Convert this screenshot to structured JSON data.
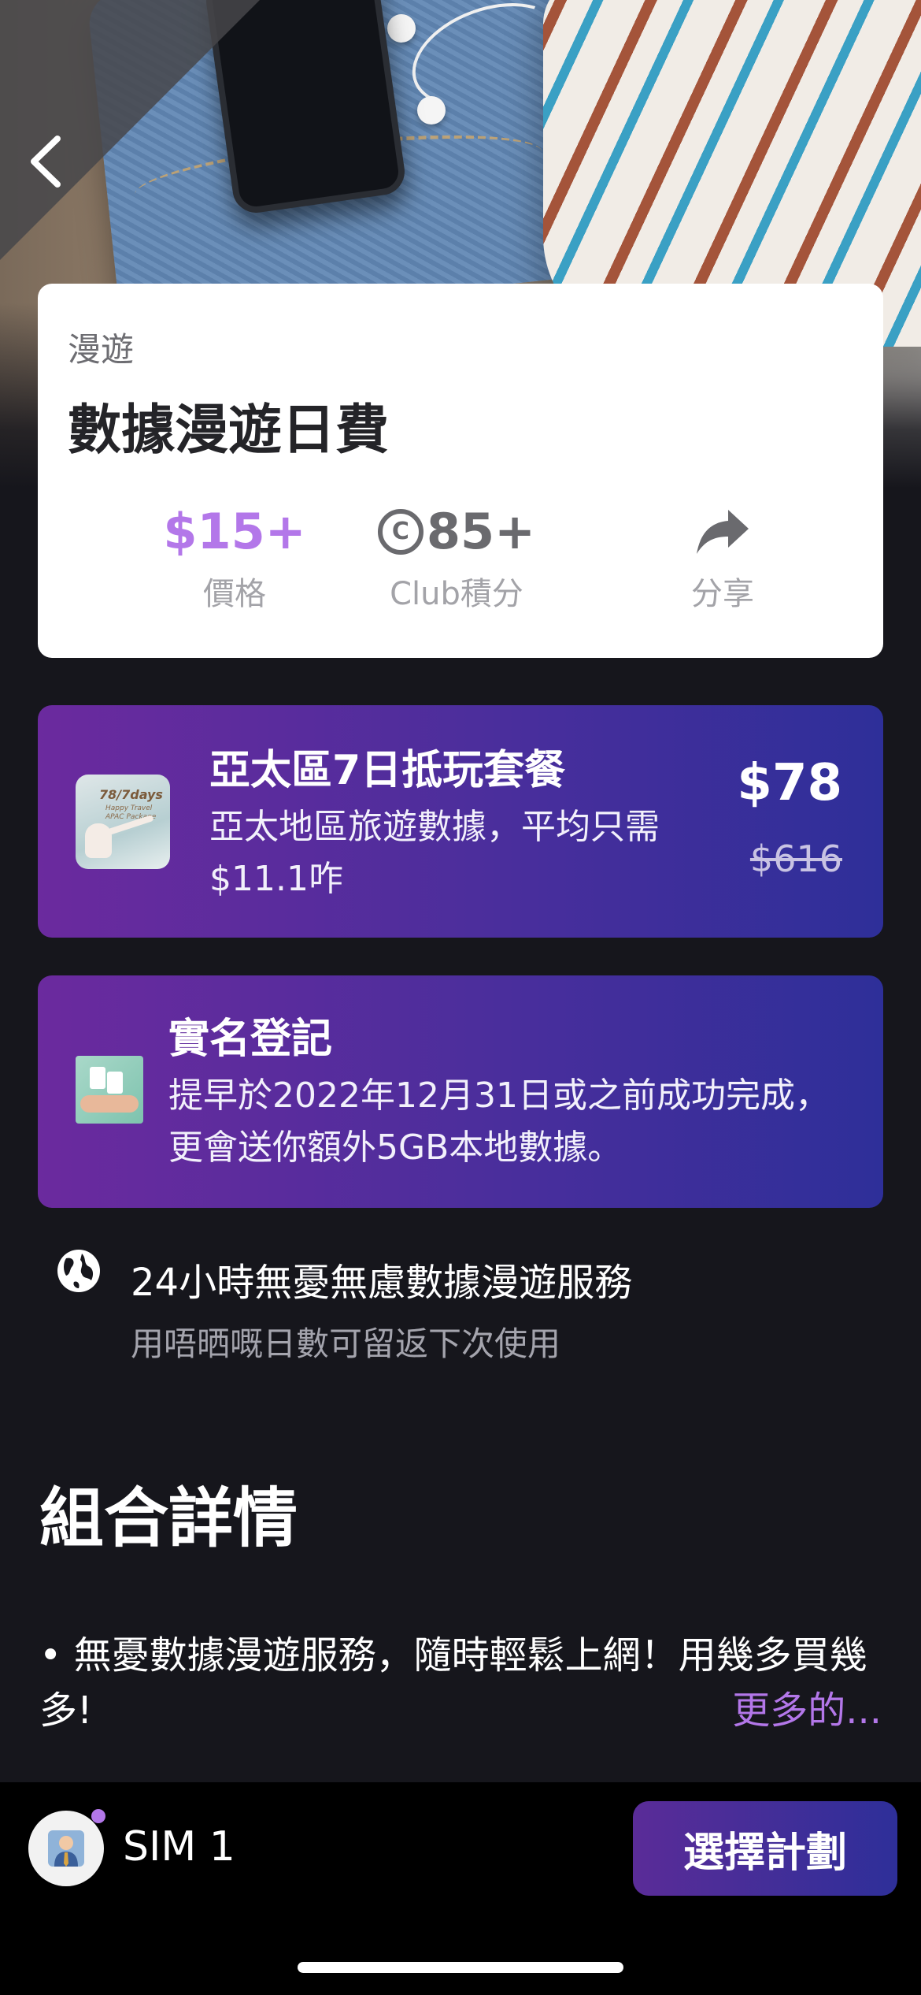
{
  "product": {
    "category": "漫遊",
    "title": "數據漫遊日費",
    "price": "$15+",
    "price_label": "價格",
    "points_icon_letter": "C",
    "points": "85+",
    "points_label": "Club積分",
    "share_label": "分享"
  },
  "promo_package": {
    "title": "亞太區7日抵玩套餐",
    "description": "亞太地區旅遊數據，平均只需$11.1咋",
    "price": "$78",
    "original_price": "$616",
    "thumb_text": "78/7days",
    "thumb_subtext": "Happy Travel APAC Package"
  },
  "registration": {
    "title": "實名登記",
    "description": "提早於2022年12月31日或之前成功完成，更會送你額外5GB本地數據。"
  },
  "feature": {
    "icon": "globe-icon",
    "title": "24小時無憂無慮數據漫遊服務",
    "subtitle": "用唔晒嘅日數可留返下次使用"
  },
  "details": {
    "heading": "組合詳情",
    "text": "• 無憂數據漫遊服務，隨時輕鬆上網！用幾多買幾多!",
    "more_link": "更多的..."
  },
  "bottom_bar": {
    "sim_label": "SIM 1",
    "cta_label": "選擇計劃"
  },
  "colors": {
    "accent": "#b377e9",
    "promo_gradient_start": "#6b2a9e",
    "promo_gradient_end": "#2e2f99",
    "background": "#16161c"
  }
}
